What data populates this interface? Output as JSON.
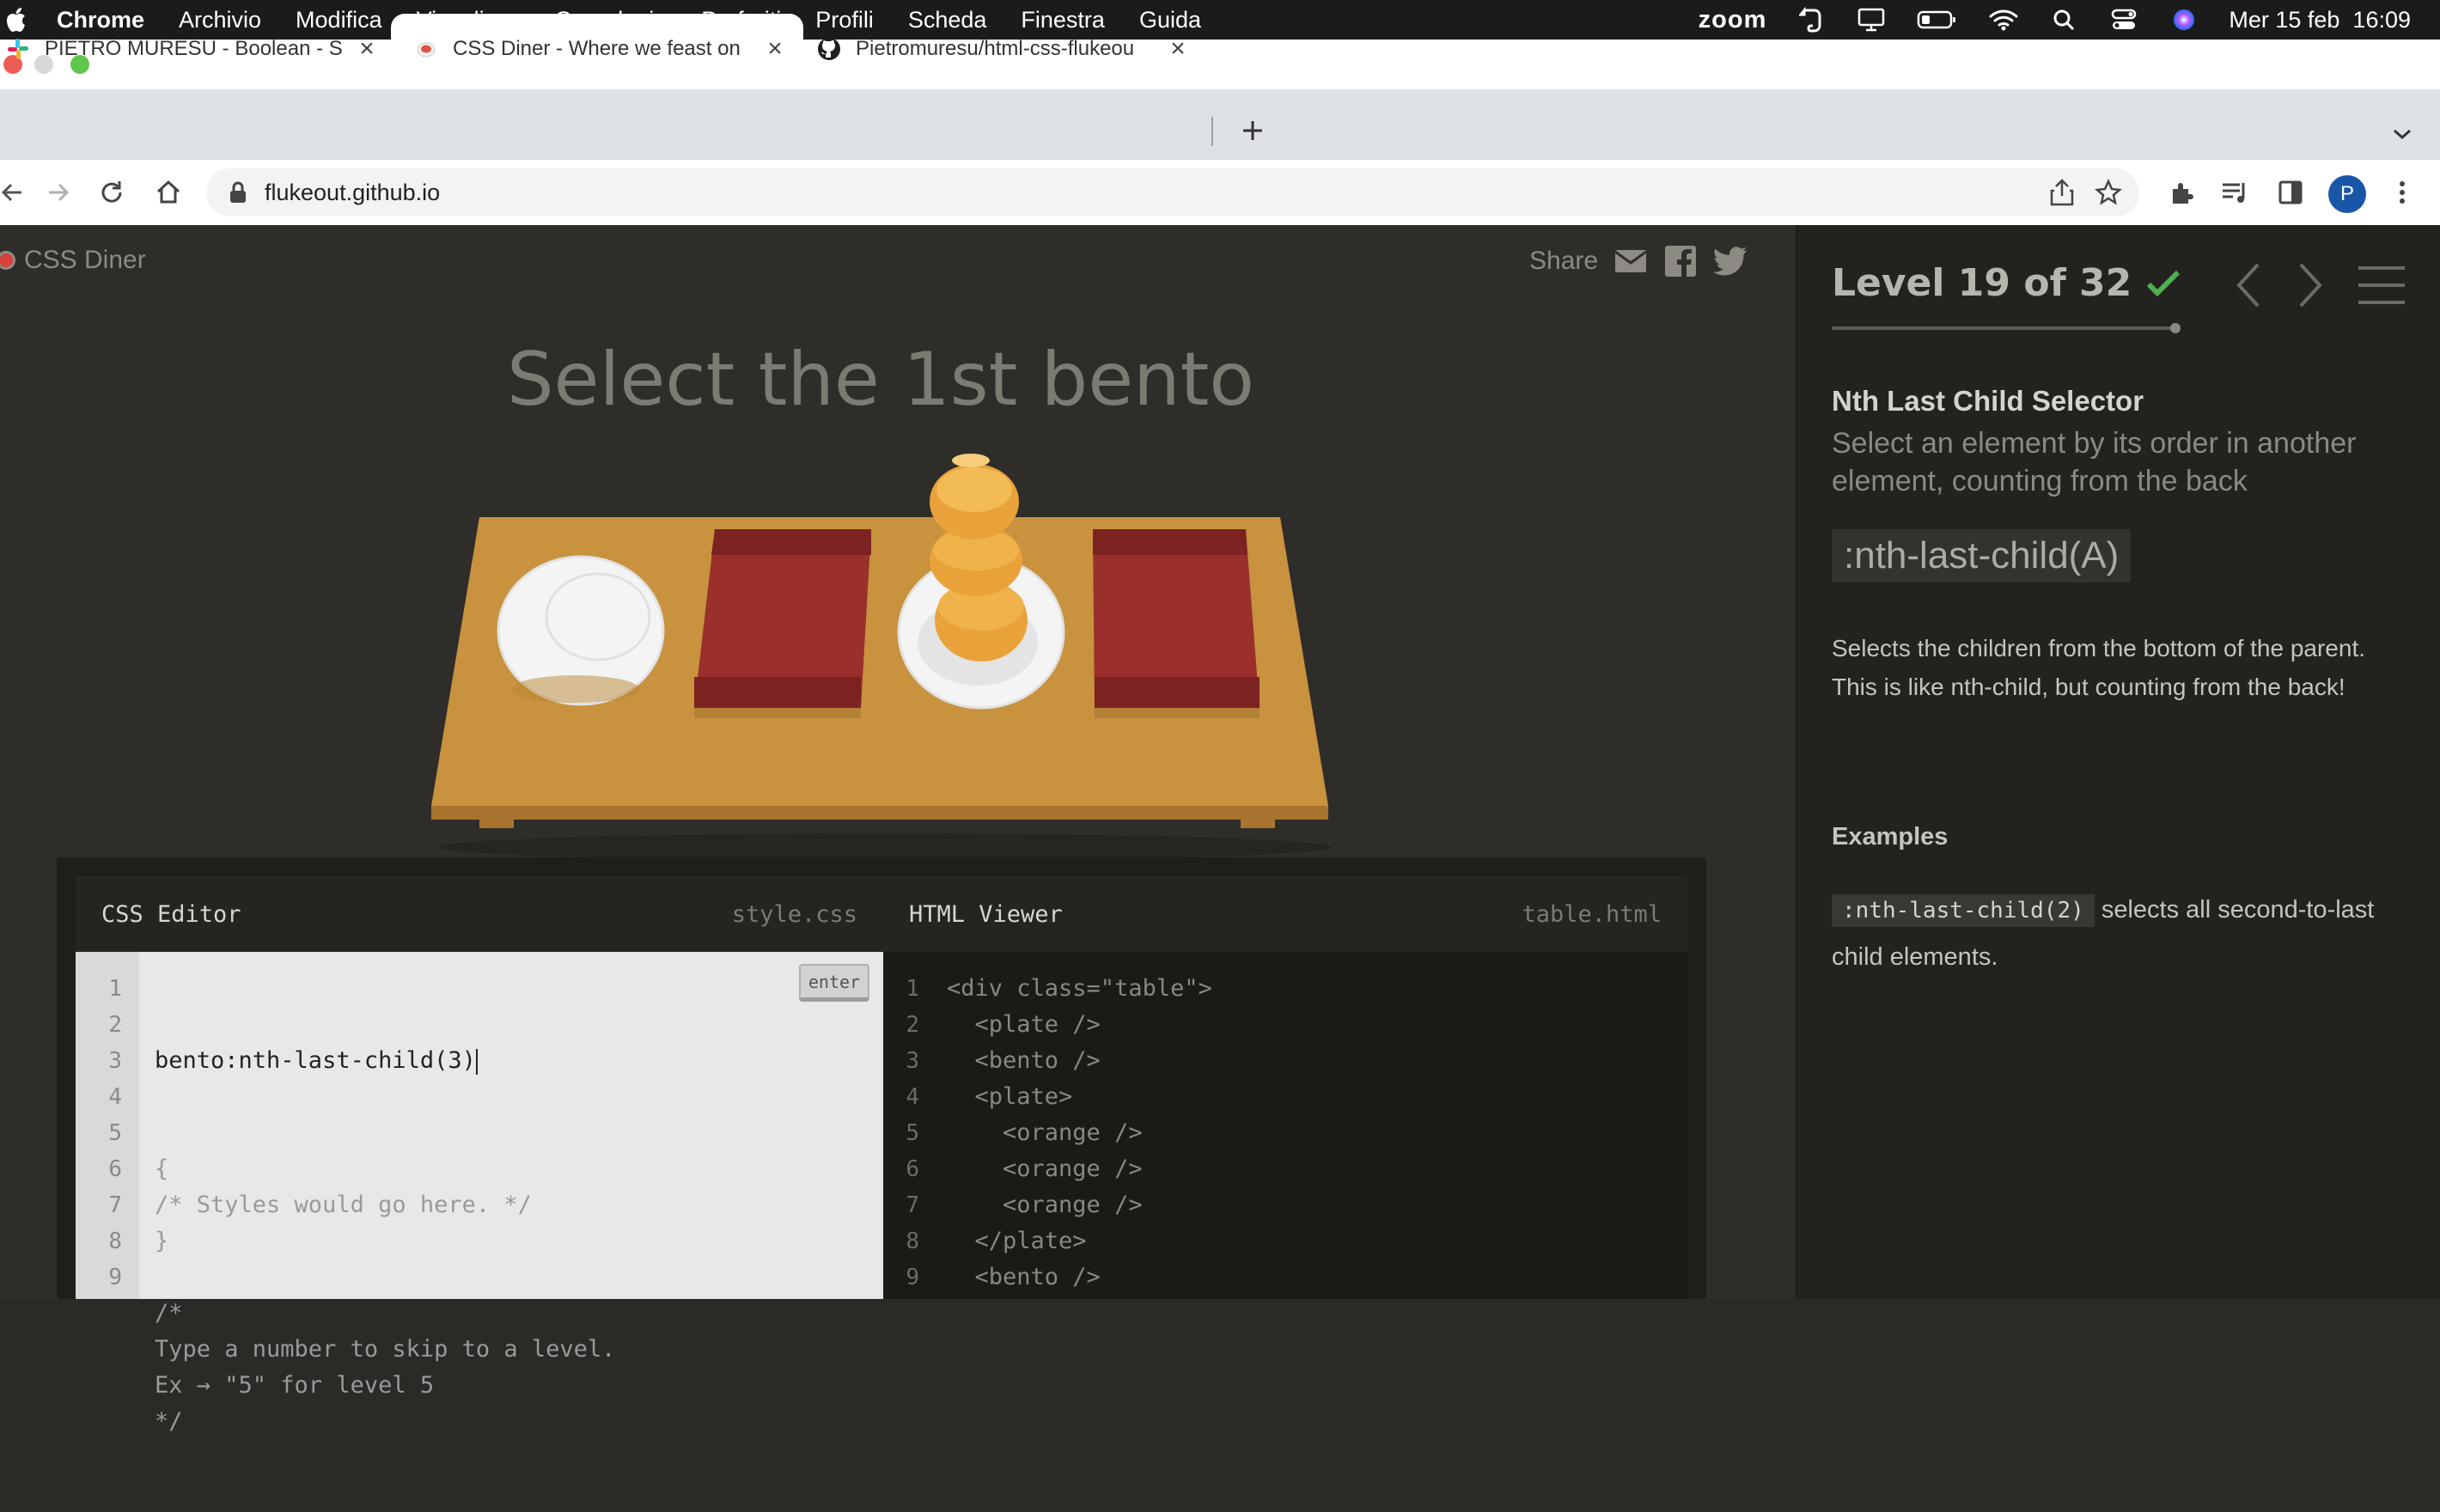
{
  "menubar": {
    "app": "Chrome",
    "items": [
      "Archivio",
      "Modifica",
      "Visualizza",
      "Cronologia",
      "Preferiti",
      "Profili",
      "Scheda",
      "Finestra",
      "Guida"
    ],
    "zoom_label": "zoom",
    "datetime": "Mer 15 feb  16:09"
  },
  "tabs": [
    {
      "title": "PIETRO MURESU - Boolean - S",
      "active": false,
      "icon": "slack-icon"
    },
    {
      "title": "CSS Diner - Where we feast on",
      "active": true,
      "icon": "css-diner-icon"
    },
    {
      "title": "Pietromuresu/html-css-flukeou",
      "active": false,
      "icon": "github-icon"
    }
  ],
  "toolbar": {
    "url": "flukeout.github.io",
    "profile_initial": "P"
  },
  "game": {
    "brand": "CSS Diner",
    "share_label": "Share",
    "order": "Select the 1st bento"
  },
  "editor": {
    "css_title": "CSS Editor",
    "css_file": "style.css",
    "html_title": "HTML Viewer",
    "html_file": "table.html",
    "enter_label": "enter",
    "css_line_numbers": [
      "1",
      "2",
      "3",
      "4",
      "5",
      "6",
      "7",
      "8",
      "9"
    ],
    "css_input": "bento:nth-last-child(3)",
    "css_lines_rest": "{\n/* Styles would go here. */\n}\n\n/*\nType a number to skip to a level.\nEx → \"5\" for level 5\n*/",
    "html_line_numbers": [
      "1",
      "2",
      "3",
      "4",
      "5",
      "6",
      "7",
      "8",
      "9"
    ],
    "html_code": "<div class=\"table\">\n  <plate />\n  <bento />\n  <plate>\n    <orange />\n    <orange />\n    <orange />\n  </plate>\n  <bento />"
  },
  "sidebar": {
    "level": "Level 19 of 32",
    "progress": 0.59,
    "selector_name": "Nth Last Child Selector",
    "title": "Select an element by its order in another element, counting from the back",
    "syntax": ":nth-last-child(A)",
    "hint": "Selects the children from the bottom of the parent. This is like nth-child, but counting from the back!",
    "examples_title": "Examples",
    "example_code": ":nth-last-child(2)",
    "example_text": " selects all second-to-last child elements."
  },
  "colors": {
    "check": "#4caf50",
    "table_wood": "#c8923f",
    "bento_red": "#9a2f2c",
    "orange": "#e9a23a"
  }
}
